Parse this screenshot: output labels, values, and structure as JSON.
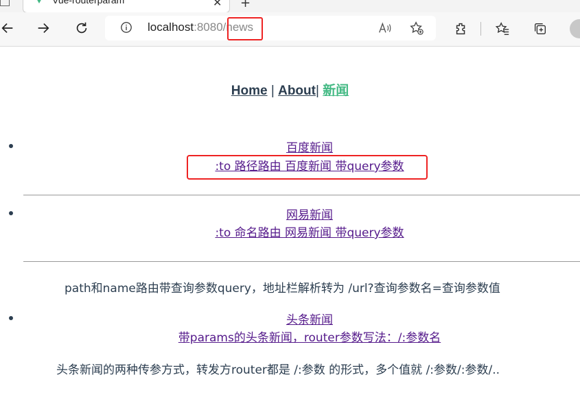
{
  "browser": {
    "tab_title": "Vue-routerparam",
    "tab_close": "✕",
    "new_tab": "+",
    "url_host": "localhost",
    "url_port": ":8080/",
    "url_path": "news",
    "icons": [
      "back-icon",
      "forward-icon",
      "refresh-icon",
      "info-icon",
      "read-aloud-icon",
      "add-favorite-icon",
      "extensions-icon",
      "favorites-icon",
      "collections-icon",
      "profile-icon"
    ]
  },
  "nav": {
    "home": "Home",
    "sep1": " | ",
    "about": "About",
    "sep2": "| ",
    "news": "新闻"
  },
  "items": [
    {
      "title": "百度新闻",
      "link": ":to 路径路由 百度新闻 带query参数"
    },
    {
      "title": "网易新闻",
      "link": ":to 命名路由 网易新闻 带query参数"
    },
    {
      "title": "头条新闻",
      "link": "带params的头条新闻，router参数写法：/:参数名"
    }
  ],
  "notes": {
    "query_note": "path和name路由带查询参数query，地址栏解析转为 /url?查询参数名=查询参数值",
    "params_note": "头条新闻的两种传参方式，转发方router都是 /:参数 的形式，多个值就 /:参数/:参数/.."
  },
  "colors": {
    "link": "#551a8b",
    "active": "#42b983",
    "text": "#2c3e50",
    "highlight": "#e22222"
  }
}
